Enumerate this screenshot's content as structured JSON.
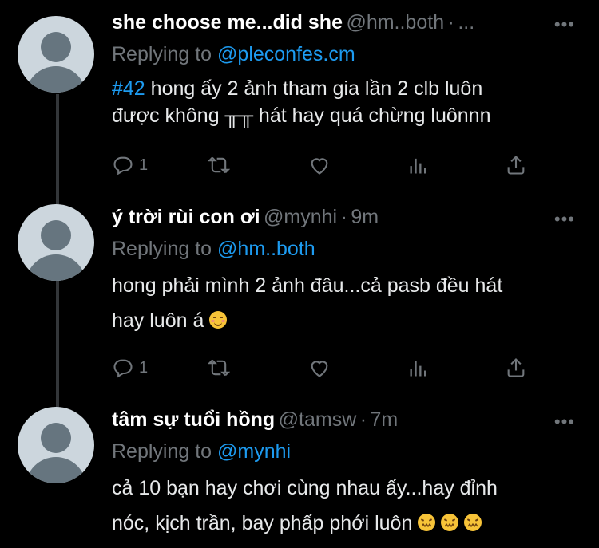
{
  "tweets": [
    {
      "name": "she choose me...did she",
      "handle": "@hm..both",
      "separator": "·",
      "time": "...",
      "replying_prefix": "Replying to",
      "replying_to": "@pleconfes.cm",
      "hashtag": "#42",
      "text_line1": " hong ấy 2 ảnh tham gia lần 2 clb luôn",
      "text_line2": "được không ╥╥ hát hay quá chừng luônnn",
      "reply_count": "1",
      "more": "•••"
    },
    {
      "name": "ý trời rùi con ơi",
      "handle": "@mynhi",
      "separator": "·",
      "time": "9m",
      "replying_prefix": "Replying to",
      "replying_to": "@hm..both",
      "text_line1": "hong phải mình 2 ảnh đâu...cả pasb đều hát",
      "text_line2": "hay luôn á",
      "reply_count": "1",
      "more": "•••"
    },
    {
      "name": "tâm sự tuổi hồng",
      "handle": "@tamsw",
      "separator": "·",
      "time": "7m",
      "replying_prefix": "Replying to",
      "replying_to": "@mynhi",
      "text_line1": "cả 10 bạn hay chơi cùng nhau ấy...hay đỉnh",
      "text_line2": "nóc, kịch trần, bay phấp phới luôn",
      "more": "•••"
    }
  ],
  "colors": {
    "background": "#000000",
    "text": "#e7e9ea",
    "secondary": "#71767b",
    "accent": "#1d9bf0",
    "thread_line": "#333639"
  },
  "icons": [
    "reply-icon",
    "retweet-icon",
    "like-icon",
    "views-icon",
    "share-icon"
  ]
}
